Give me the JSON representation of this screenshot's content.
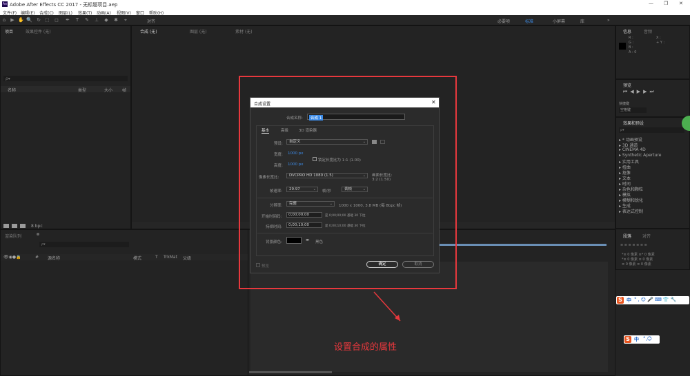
{
  "app": {
    "title": "Adobe After Effects CC 2017 - 无标题项目.aep",
    "logo": "Ae",
    "win_controls": [
      "—",
      "❐",
      "✕"
    ]
  },
  "menu": [
    "文件(F)",
    "编辑(E)",
    "合成(C)",
    "图层(L)",
    "效果(T)",
    "动画(A)",
    "视图(V)",
    "窗口",
    "帮助(H)"
  ],
  "toolbar": {
    "tools": [
      "⌂",
      "▶",
      "✋",
      "🔍",
      "↻",
      "⬚",
      "◻",
      "✒",
      "T",
      "✎",
      "⊥",
      "◆",
      "✱",
      "⌖"
    ],
    "snap_label": "对齐",
    "workspaces": [
      "必要项",
      "标准",
      "小屏幕",
      "库"
    ],
    "overflow": "»"
  },
  "project_panel": {
    "tabs": [
      "项目",
      "效果控件 (无)"
    ],
    "search_placeholder": "ρ▾",
    "columns": [
      "名称",
      "类型",
      "大小",
      "帧"
    ],
    "bpc": "8 bpc"
  },
  "comp_viewer": {
    "tabs": [
      "合成 (无)",
      "图层 (无)",
      "素材 (无)"
    ]
  },
  "info_panel": {
    "tabs": [
      "信息",
      "音频"
    ],
    "rows": [
      [
        "R :",
        "X :"
      ],
      [
        "G :",
        "+ Y :"
      ],
      [
        "B :",
        ""
      ],
      [
        "A : 0",
        ""
      ]
    ]
  },
  "preview_panel": {
    "tab": "预览",
    "shortcut_label": "快捷键",
    "shortcut_value": "空格键"
  },
  "effects_panel": {
    "tab": "效果和预设",
    "search_placeholder": "ρ▾",
    "items": [
      "* 动画预设",
      "3D 通道",
      "CINEMA 4D",
      "Synthetic Aperture",
      "实用工具",
      "扭曲",
      "抠像",
      "文本",
      "时间",
      "杂色和颗粒",
      "模拟",
      "模糊和锐化",
      "生成",
      "表达式控制"
    ]
  },
  "align_panel": {
    "tabs": [
      "段落",
      "对齐"
    ],
    "rows": [
      "*≡ 0 像素    ≡* 0 像素",
      "*≡ 0 像素    ≡ 0 像素",
      "≡ 0 像素    ≡ 0 像素"
    ]
  },
  "timeline": {
    "tab": "渲染队列",
    "search_placeholder": "ρ▾",
    "columns": [
      "#",
      "源名称",
      "模式",
      "T",
      "TrkMat",
      "父级"
    ]
  },
  "dialog": {
    "title": "合成设置",
    "close": "✕",
    "name_label": "合成名称:",
    "name_value": "合成 1",
    "tabs": [
      "基本",
      "高级",
      "3D 渲染器"
    ],
    "preset_label": "预设:",
    "preset_value": "自定义",
    "width_label": "宽度:",
    "width_value": "1000 px",
    "lock_label": "锁定长宽比为 1:1 (1.00)",
    "height_label": "高度:",
    "height_value": "1000 px",
    "par_label": "像素长宽比:",
    "par_value": "DVCPRO HD 1080 (1.5)",
    "frame_ar_label": "画面长宽比:",
    "frame_ar_value": "3:2 (1.50)",
    "fps_label": "帧速率:",
    "fps_value": "29.97",
    "fps_unit": "帧/秒",
    "fps_mode": "丢帧",
    "res_label": "分辨率:",
    "res_value": "完整",
    "res_info": "1000 x 1000, 3.8 MB (每 8bpc 帧)",
    "start_label": "开始时间码:",
    "start_value": "0;00;00;00",
    "start_info": "是 0;00;00;00  基础 30  下拉",
    "dur_label": "持续时间:",
    "dur_value": "0;00;10;00",
    "dur_info": "是 0;00;10;00  基础 30  下拉",
    "bg_label": "背景颜色:",
    "bg_name": "黑色",
    "bg_color": "#000000",
    "preview_label": "预览",
    "ok": "确定",
    "cancel": "取消"
  },
  "annotation": "设置合成的属性",
  "ime": {
    "logo": "S",
    "label": "中",
    "extras": "°,☺🎤⌨👕🔧"
  },
  "colors": {
    "accent_red": "#e8383d",
    "ae_blue": "#3d8ce8",
    "ime_orange": "#e8541e"
  }
}
